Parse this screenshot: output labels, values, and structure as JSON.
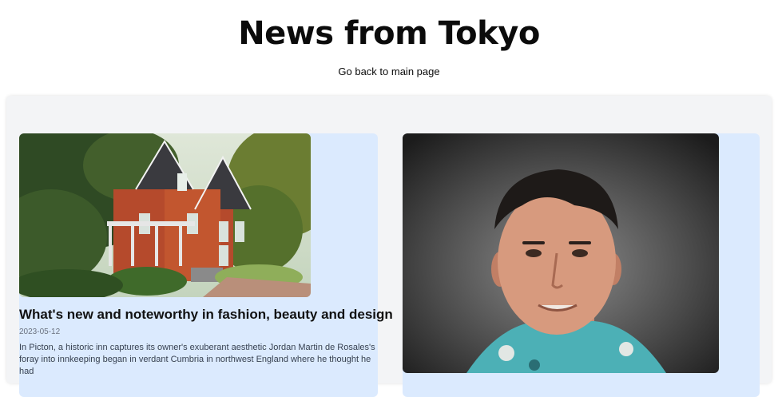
{
  "header": {
    "title": "News from Tokyo",
    "back_link": "Go back to main page"
  },
  "articles": [
    {
      "image_alt": "historic inn house",
      "title": "What's new and noteworthy in fashion, beauty and design",
      "date": "2023-05-12",
      "excerpt": "In Picton, a historic inn captures its owner's exuberant aesthetic Jordan Martin de Rosales's foray into innkeeping began in verdant Cumbria in northwest England where he thought he had"
    },
    {
      "image_alt": "portrait of smiling man"
    }
  ],
  "colors": {
    "panel_bg": "#f3f4f6",
    "card_bg": "#dbeafe",
    "text": "#111111",
    "date": "#6b7280"
  }
}
